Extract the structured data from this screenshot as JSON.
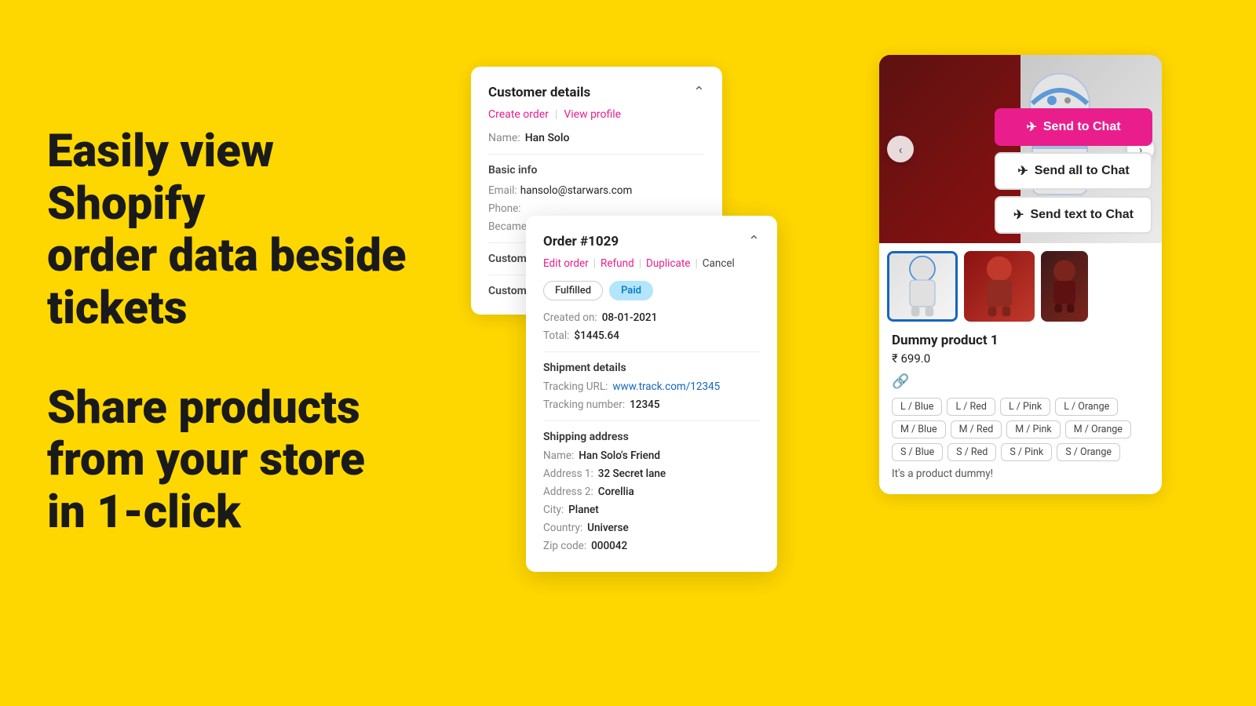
{
  "background_color": "#FFD700",
  "left_section": {
    "headline1": "Easily view Shopify",
    "headline2": "order data beside",
    "headline3": "tickets",
    "headline4": "Share products",
    "headline5": "from your store",
    "headline6": "in 1-click"
  },
  "customer_card": {
    "title": "Customer details",
    "actions": {
      "create_order": "Create order",
      "separator": "|",
      "view_profile": "View profile"
    },
    "name_label": "Name:",
    "name_value": "Han Solo",
    "basic_info_title": "Basic info",
    "email_label": "Email:",
    "email_value": "hansolo@starwars.com",
    "phone_label": "Phone:",
    "became_label": "Became",
    "custom_label1": "Custom",
    "custom_label2": "Custom"
  },
  "order_card": {
    "title": "Order #1029",
    "actions": {
      "edit_order": "Edit order",
      "sep1": "|",
      "refund": "Refund",
      "sep2": "|",
      "duplicate": "Duplicate",
      "sep3": "|",
      "cancel": "Cancel"
    },
    "badges": {
      "fulfilled": "Fulfilled",
      "paid": "Paid"
    },
    "created_label": "Created on:",
    "created_value": "08-01-2021",
    "total_label": "Total:",
    "total_value": "$1445.64",
    "shipment_title": "Shipment details",
    "tracking_url_label": "Tracking URL:",
    "tracking_url_value": "www.track.com/12345",
    "tracking_number_label": "Tracking number:",
    "tracking_number_value": "12345",
    "shipping_title": "Shipping address",
    "ship_name_label": "Name:",
    "ship_name_value": "Han Solo's Friend",
    "address1_label": "Address 1:",
    "address1_value": "32 Secret lane",
    "address2_label": "Address 2:",
    "address2_value": "Corellia",
    "city_label": "City:",
    "city_value": "Planet",
    "country_label": "Country:",
    "country_value": "Universe",
    "zip_label": "Zip code:",
    "zip_value": "000042"
  },
  "product_card": {
    "send_to_chat_label": "Send to Chat",
    "send_all_to_chat_label": "Send all to Chat",
    "send_text_to_chat_label": "Send text to Chat",
    "carousel_arrow_left": "‹",
    "carousel_arrow_right": "›",
    "product_name": "Dummy product 1",
    "product_price": "₹ 699.0",
    "link_icon": "🔗",
    "variants": [
      "L / Blue",
      "L / Red",
      "L / Pink",
      "L / Orange",
      "M / Blue",
      "M / Red",
      "M / Pink",
      "M / Orange",
      "S / Blue",
      "S / Red",
      "S / Pink",
      "S / Orange"
    ],
    "description": "It's a product dummy!"
  }
}
